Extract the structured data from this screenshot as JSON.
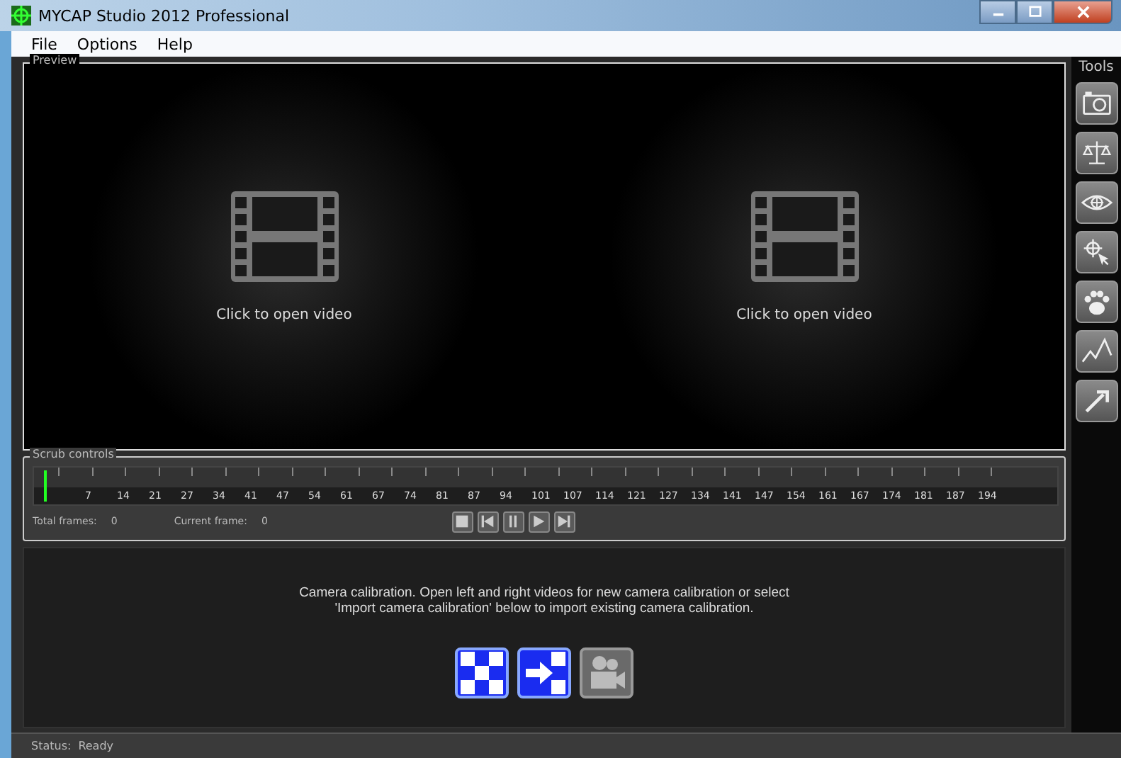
{
  "window": {
    "title": "MYCAP Studio 2012 Professional"
  },
  "menu": [
    "File",
    "Options",
    "Help"
  ],
  "preview": {
    "title": "Preview",
    "panes": [
      {
        "label": "Click to open video"
      },
      {
        "label": "Click to open video"
      }
    ]
  },
  "scrub": {
    "title": "Scrub controls",
    "level": 0,
    "ticks": [
      "7",
      "14",
      "21",
      "27",
      "34",
      "41",
      "47",
      "54",
      "61",
      "67",
      "74",
      "81",
      "87",
      "94",
      "101",
      "107",
      "114",
      "121",
      "127",
      "134",
      "141",
      "147",
      "154",
      "161",
      "167",
      "174",
      "181",
      "187",
      "194"
    ],
    "total_frames_label": "Total frames:",
    "total_frames": "0",
    "current_frame_label": "Current frame:",
    "current_frame": "0",
    "transport": [
      {
        "kind": "stop"
      },
      {
        "kind": "start"
      },
      {
        "kind": "pause"
      },
      {
        "kind": "play"
      },
      {
        "kind": "end"
      }
    ]
  },
  "calibration": {
    "message": "Camera calibration. Open left and right videos for new camera calibration or select\n'Import camera calibration' below to import existing camera calibration.",
    "buttons": [
      {
        "kind": "checkerboard",
        "disabled": false
      },
      {
        "kind": "import",
        "disabled": false
      },
      {
        "kind": "camera",
        "disabled": true
      }
    ]
  },
  "tools": {
    "title": "Tools",
    "buttons": [
      {
        "kind": "camera"
      },
      {
        "kind": "scale"
      },
      {
        "kind": "eye"
      },
      {
        "kind": "target"
      },
      {
        "kind": "paw"
      },
      {
        "kind": "graph"
      },
      {
        "kind": "arrow"
      }
    ]
  },
  "status_bar": {
    "label": "Status:",
    "value": "Ready"
  }
}
